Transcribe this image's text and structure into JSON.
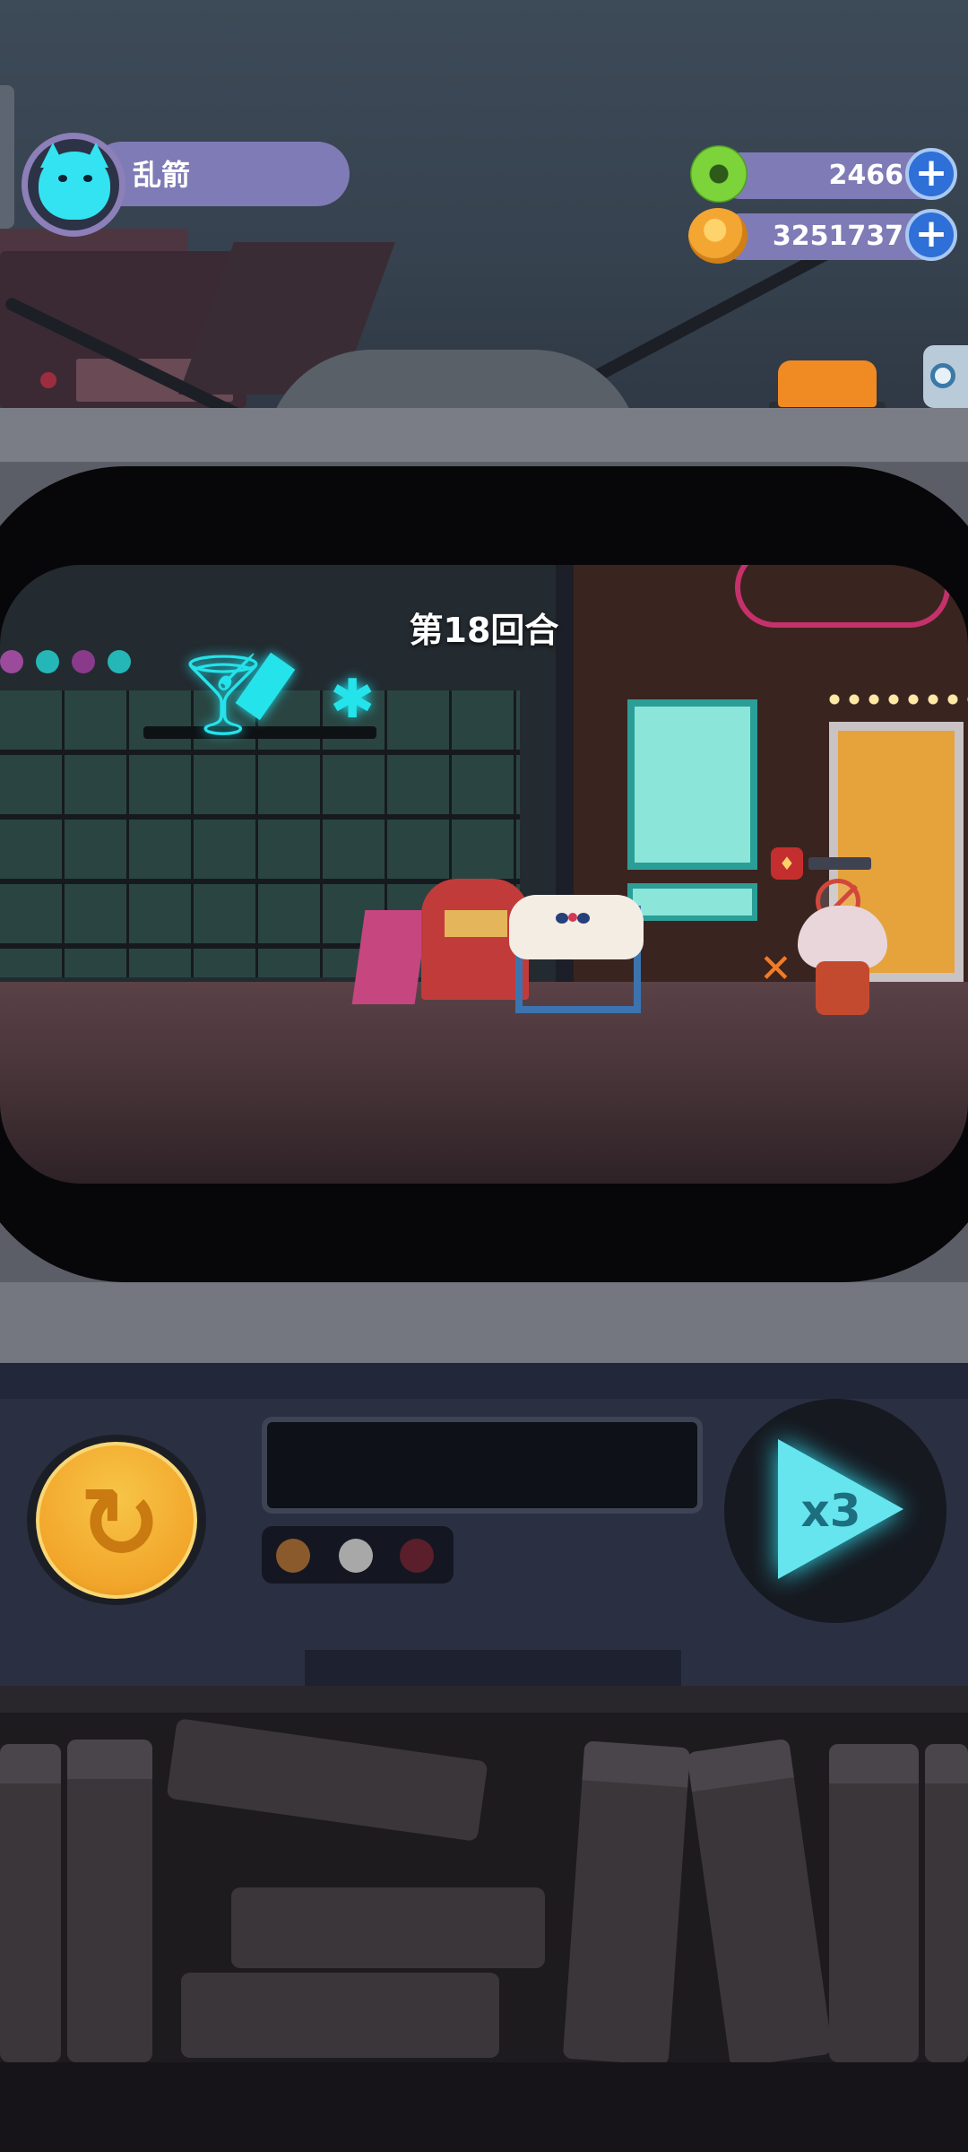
{
  "player": {
    "name": "乱箭",
    "avatar_icon": "cyan-cat-avatar-icon"
  },
  "currencies": {
    "gems": {
      "value": "2466",
      "icon": "green-donut-gem-icon",
      "color": "#7cd43a"
    },
    "coins": {
      "value": "3251737",
      "icon": "orange-planet-coin-icon",
      "color": "#f3a632"
    }
  },
  "game": {
    "round_label": "第18回合"
  },
  "controls": {
    "speed_label": "x3",
    "reset_icon": "refresh-icon",
    "indicators": [
      "#8a5a2c",
      "#a8a8a8",
      "#5a1f2b"
    ]
  },
  "colors": {
    "accent": "#34e3f1",
    "hud_bar": "#7f7bb6",
    "reset_button": "#f2a62a",
    "speed_button": "#66e5ee"
  }
}
